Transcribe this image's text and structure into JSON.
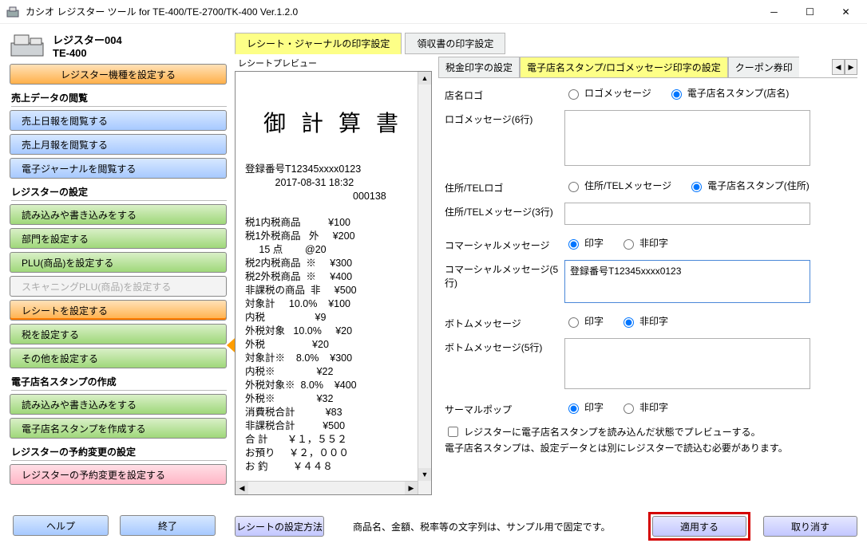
{
  "window": {
    "title": "カシオ レジスター ツール for TE-400/TE-2700/TK-400 Ver.1.2.0"
  },
  "register": {
    "name": "レジスター004",
    "model": "TE-400",
    "set_model_btn": "レジスター機種を設定する"
  },
  "left": {
    "sec_sales": "売上データの閲覧",
    "sales": [
      "売上日報を閲覧する",
      "売上月報を閲覧する",
      "電子ジャーナルを閲覧する"
    ],
    "sec_settings": "レジスターの設定",
    "settings": [
      "読み込みや書き込みをする",
      "部門を設定する",
      "PLU(商品)を設定する",
      "スキャニングPLU(商品)を設定する",
      "レシートを設定する",
      "税を設定する",
      "その他を設定する"
    ],
    "sec_stamp": "電子店名スタンプの作成",
    "stamp": [
      "読み込みや書き込みをする",
      "電子店名スタンプを作成する"
    ],
    "sec_resv": "レジスターの予約変更の設定",
    "resv_btn": "レジスターの予約変更を設定する",
    "help": "ヘルプ",
    "exit": "終了"
  },
  "main_tabs": [
    "レシート・ジャーナルの印字設定",
    "領収書の印字設定"
  ],
  "preview": {
    "group_label": "レシートプレビュー",
    "title": "御 計 算 書",
    "reg_no": "登録番号T12345xxxx0123",
    "datetime": "2017-08-31 18:32",
    "seq": "000138",
    "lines": [
      "税1内税商品          ¥100",
      "税1外税商品   外     ¥200",
      "     15 点        @20",
      "税2内税商品  ※     ¥300",
      "税2外税商品  ※     ¥400",
      "非課税の商品  非     ¥500",
      "対象計     10.0%    ¥100",
      "内税                  ¥9",
      "外税対象   10.0%     ¥20",
      "外税                 ¥20",
      "対象計※    8.0%    ¥300",
      "内税※               ¥22",
      "外税対象※  8.0%    ¥400",
      "外税※               ¥32",
      "消費税合計           ¥83",
      "非課税合計          ¥500",
      "合 計       ￥１，５５２",
      "お預り     ￥２，０００",
      "お 釣         ￥４４８"
    ]
  },
  "sub_tabs": [
    "税金印字の設定",
    "電子店名スタンプ/ロゴメッセージ印字の設定",
    "クーポン券印"
  ],
  "settings": {
    "shop_logo_label": "店名ロゴ",
    "shop_logo_opts": [
      "ロゴメッセージ",
      "電子店名スタンプ(店名)"
    ],
    "logo_msg_label": "ロゴメッセージ(6行)",
    "addr_label": "住所/TELロゴ",
    "addr_opts": [
      "住所/TELメッセージ",
      "電子店名スタンプ(住所)"
    ],
    "addr_msg_label": "住所/TELメッセージ(3行)",
    "comm_label": "コマーシャルメッセージ",
    "print_opts": [
      "印字",
      "非印字"
    ],
    "comm_msg_label": "コマーシャルメッセージ(5行)",
    "comm_msg_value": "登録番号T12345xxxx0123",
    "bottom_label": "ボトムメッセージ",
    "bottom_msg_label": "ボトムメッセージ(5行)",
    "thermal_label": "サーマルポップ",
    "chk_label": "レジスターに電子店名スタンプを読み込んだ状態でプレビューする。",
    "note": "電子店名スタンプは、設定データとは別にレジスターで読込む必要があります。"
  },
  "bottom": {
    "howto": "レシートの設定方法",
    "sample_note": "商品名、金額、税率等の文字列は、サンプル用で固定です。",
    "apply": "適用する",
    "cancel": "取り消す"
  }
}
